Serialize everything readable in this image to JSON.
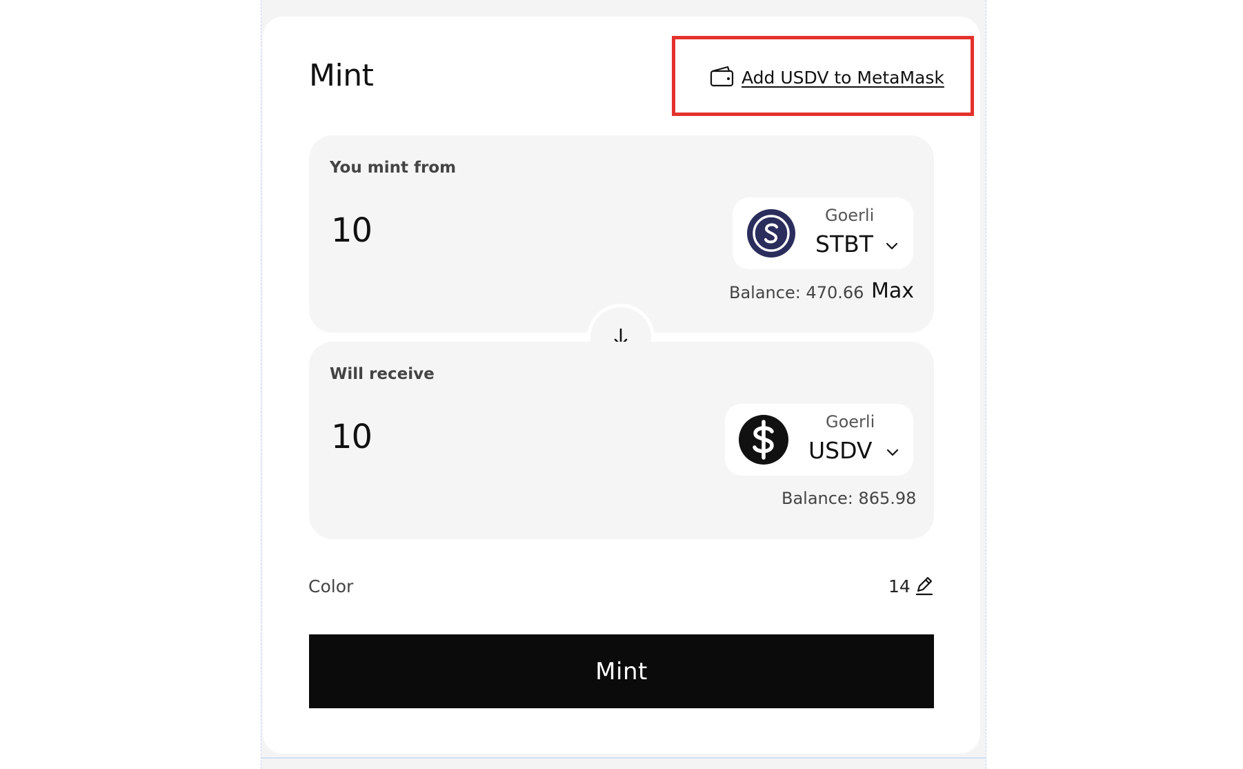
{
  "header": {
    "title": "Mint",
    "add_token_link": "Add USDV to MetaMask"
  },
  "from": {
    "label": "You mint from",
    "amount": "10",
    "network": "Goerli",
    "symbol": "STBT",
    "balance": "Balance: 470.66",
    "max_label": "Max",
    "icon": "stbt-token-icon"
  },
  "to": {
    "label": "Will receive",
    "amount": "10",
    "network": "Goerli",
    "symbol": "USDV",
    "balance": "Balance: 865.98",
    "icon": "usdv-token-icon"
  },
  "color": {
    "label": "Color",
    "value": "14"
  },
  "actions": {
    "mint_label": "Mint"
  },
  "colors": {
    "highlight": "#e3322b",
    "button": "#0b0b0b",
    "card": "#f5f5f5",
    "stbt_icon": "#2b2d5c"
  }
}
